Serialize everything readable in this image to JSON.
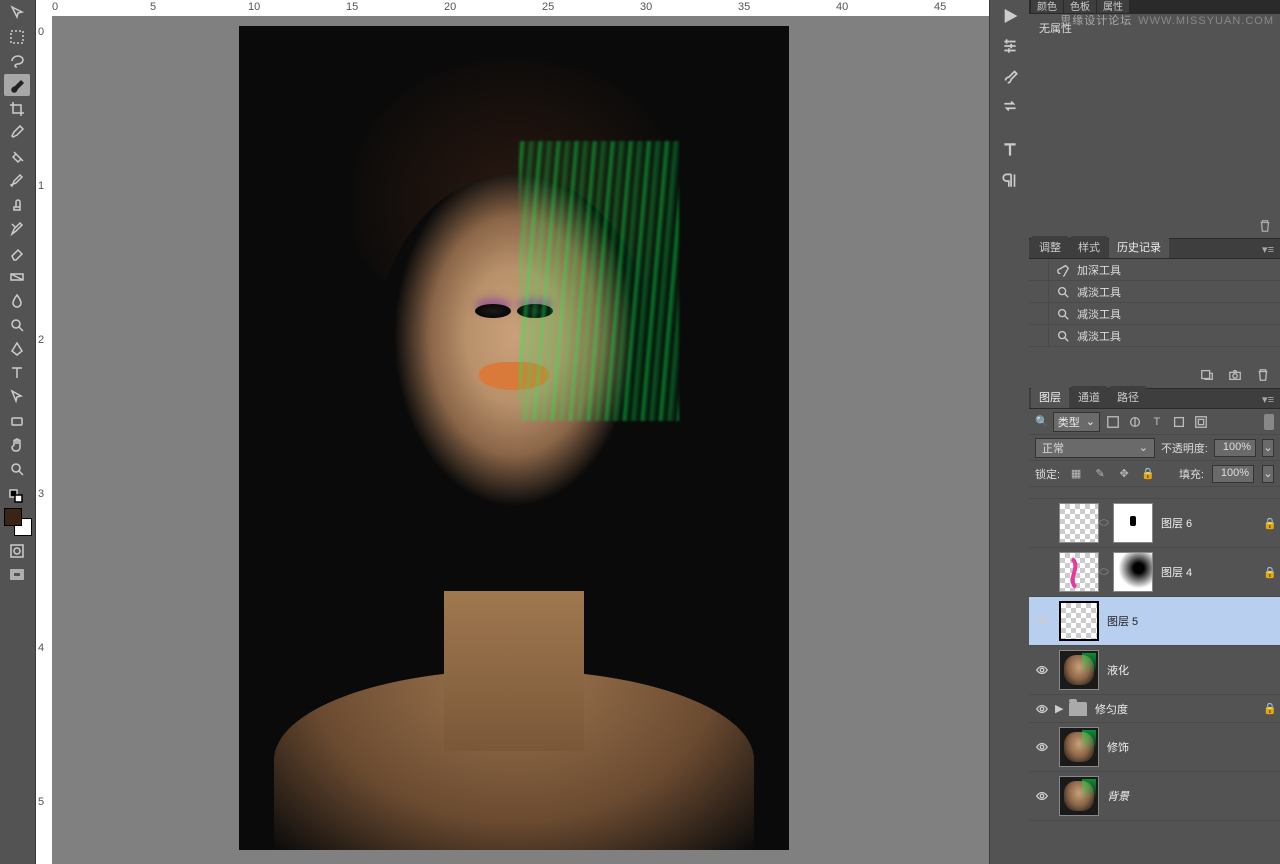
{
  "watermark": {
    "cn": "思缘设计论坛",
    "en": "WWW.MISSYUAN.COM"
  },
  "toolbox": [
    {
      "name": "move-tool"
    },
    {
      "name": "marquee-tool"
    },
    {
      "name": "lasso-tool"
    },
    {
      "name": "brush-tool",
      "active": true
    },
    {
      "name": "crop-tool"
    },
    {
      "name": "eyedropper-tool"
    },
    {
      "name": "healing-tool"
    },
    {
      "name": "paintbrush-tool"
    },
    {
      "name": "stamp-tool"
    },
    {
      "name": "history-brush-tool"
    },
    {
      "name": "eraser-tool"
    },
    {
      "name": "gradient-tool"
    },
    {
      "name": "blur-tool"
    },
    {
      "name": "dodge-tool"
    },
    {
      "name": "pen-tool"
    },
    {
      "name": "type-tool"
    },
    {
      "name": "path-select-tool"
    },
    {
      "name": "rectangle-tool"
    },
    {
      "name": "hand-tool"
    },
    {
      "name": "zoom-tool"
    }
  ],
  "ruler_h": [
    "0",
    "5",
    "10",
    "15",
    "20",
    "25",
    "30",
    "35",
    "40",
    "45"
  ],
  "ruler_v": [
    "0",
    "1",
    "2",
    "3",
    "4",
    "5"
  ],
  "right_strip": [
    {
      "name": "play-icon"
    },
    {
      "name": "sliders-icon"
    },
    {
      "name": "brush-preset-icon"
    },
    {
      "name": "swap-icon"
    },
    {
      "name": "sep"
    },
    {
      "name": "type-icon"
    },
    {
      "name": "paragraph-icon"
    }
  ],
  "top_tabs": [
    "颜色",
    "色板",
    "属性"
  ],
  "top_tabs_active": 2,
  "properties": {
    "empty_label": "无属性"
  },
  "mid_tabs": [
    "调整",
    "样式",
    "历史记录"
  ],
  "mid_tabs_active": 2,
  "history": [
    "加深工具",
    "减淡工具",
    "减淡工具",
    "减淡工具"
  ],
  "layers_tabs": [
    "图层",
    "通道",
    "路径"
  ],
  "layers_tabs_active": 0,
  "filter": {
    "label": "类型"
  },
  "blend": {
    "mode": "正常",
    "opacity_label": "不透明度:",
    "opacity_value": "100%",
    "lock_label": "锁定:",
    "fill_label": "填充:",
    "fill_value": "100%"
  },
  "layers": [
    {
      "vis": false,
      "thumb": "checker",
      "mask": true,
      "mask_style": "white-dot",
      "link": true,
      "name": "图层 6",
      "locked": true
    },
    {
      "vis": false,
      "thumb": "checker-pink",
      "mask": true,
      "mask_style": "radial",
      "link": true,
      "name": "图层 4",
      "locked": true
    },
    {
      "vis": true,
      "thumb": "checker",
      "selected": true,
      "name": "图层 5"
    },
    {
      "vis": true,
      "thumb": "face-green",
      "name": "液化"
    },
    {
      "vis": true,
      "folder": true,
      "name": "修匀度",
      "locked": true,
      "short": true
    },
    {
      "vis": true,
      "thumb": "face-green",
      "name": "修饰"
    },
    {
      "vis": true,
      "thumb": "face-green",
      "italic": true,
      "name": "背景"
    }
  ]
}
